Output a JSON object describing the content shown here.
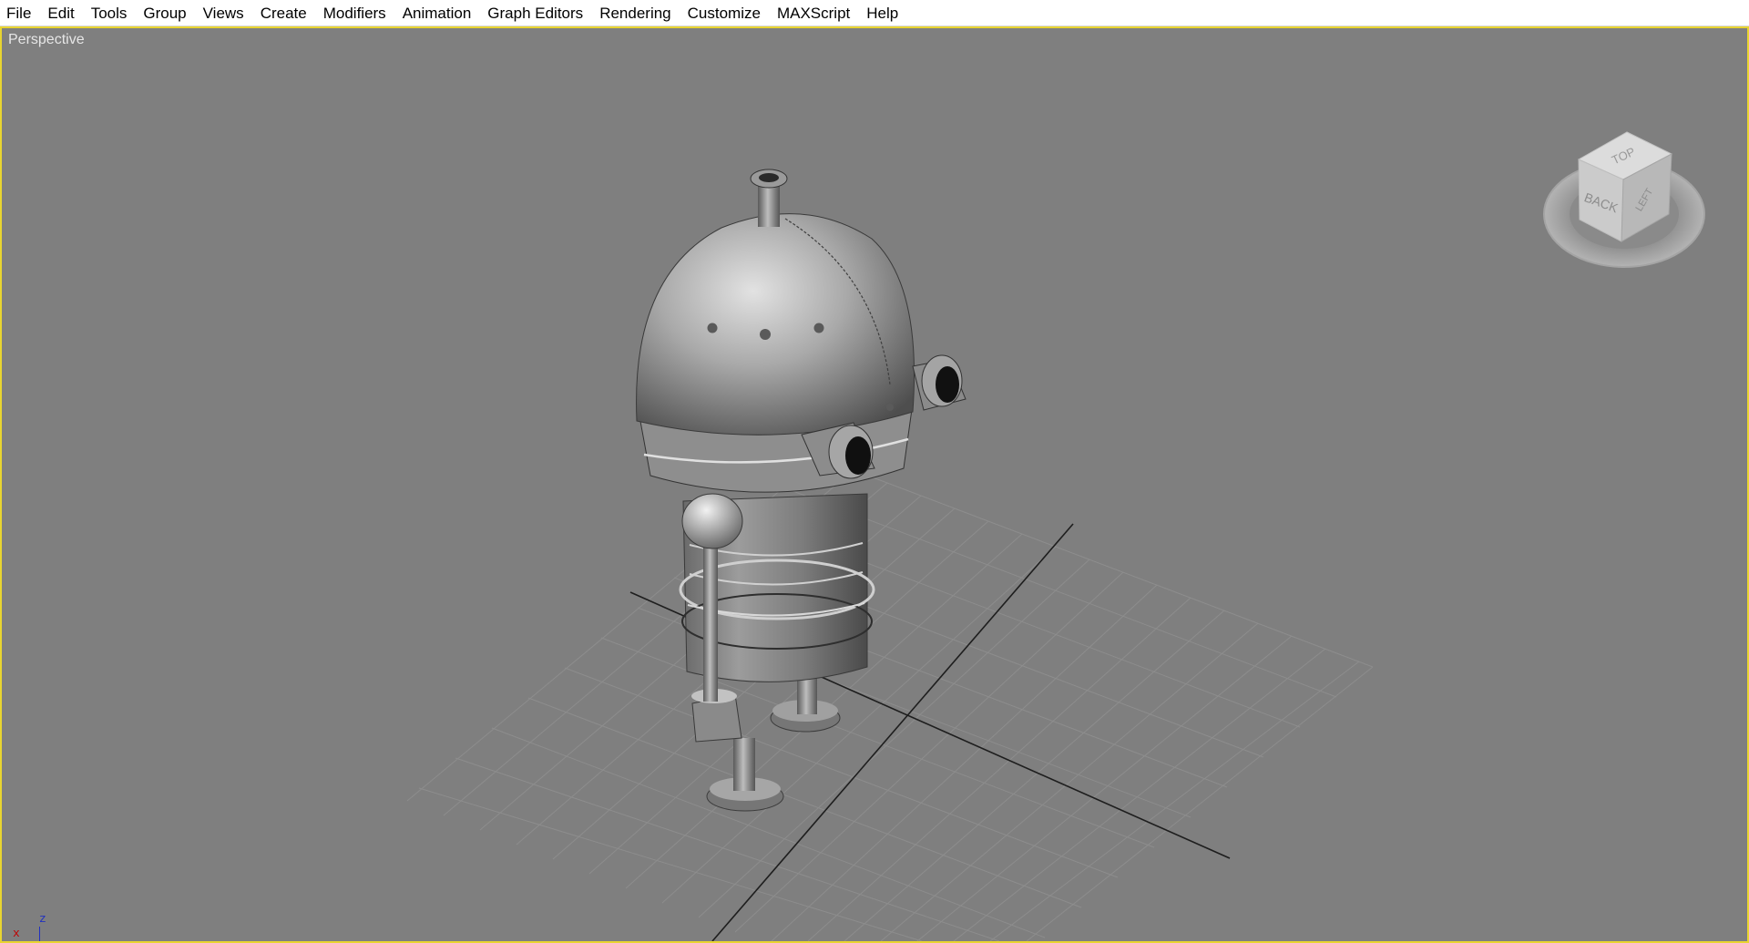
{
  "menubar": {
    "items": [
      "File",
      "Edit",
      "Tools",
      "Group",
      "Views",
      "Create",
      "Modifiers",
      "Animation",
      "Graph Editors",
      "Rendering",
      "Customize",
      "MAXScript",
      "Help"
    ]
  },
  "viewport": {
    "label": "Perspective",
    "border_color": "#e8d430",
    "background": "#7f7f7f"
  },
  "viewcube": {
    "faces": {
      "top": "TOP",
      "front": "BACK",
      "side": "LEFT"
    }
  },
  "axis_tripod": {
    "x": "x",
    "z": "z",
    "x_color": "#c00000",
    "z_color": "#2030c0"
  }
}
